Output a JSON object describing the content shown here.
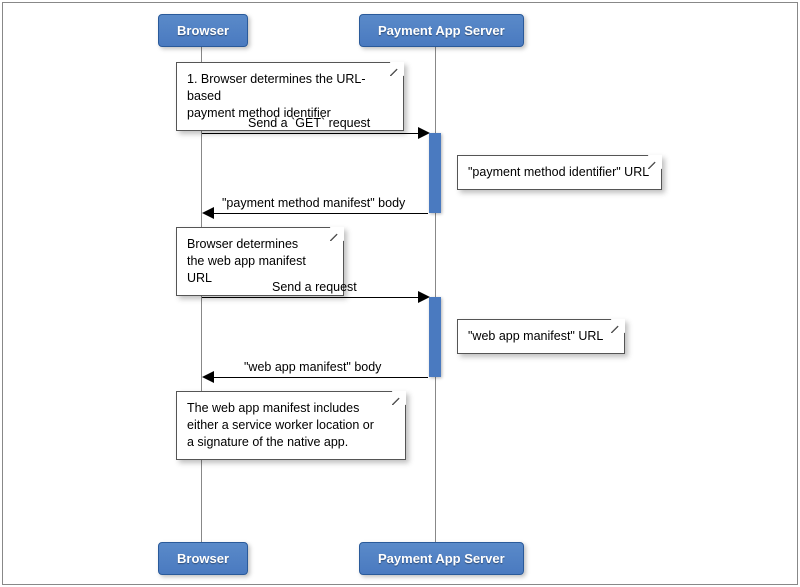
{
  "participants": {
    "browser": "Browser",
    "server": "Payment App Server"
  },
  "notes": {
    "n1": "1. Browser determines the URL-based\npayment method identifier",
    "n2": "\"payment method identifier\" URL",
    "n3": "Browser determines\nthe web app manifest URL",
    "n4": "\"web app manifest\" URL",
    "n5": "The web app manifest includes\neither a service worker location or\na signature of the native app."
  },
  "messages": {
    "m1": "Send a `GET` request",
    "m2": "\"payment method manifest\" body",
    "m3": "Send a request",
    "m4": "\"web app manifest\" body"
  },
  "chart_data": {
    "type": "table",
    "diagram_type": "uml-sequence",
    "participants": [
      "Browser",
      "Payment App Server"
    ],
    "sequence": [
      {
        "type": "note",
        "over": "Browser",
        "text": "1. Browser determines the URL-based payment method identifier"
      },
      {
        "type": "message",
        "from": "Browser",
        "to": "Payment App Server",
        "label": "Send a `GET` request"
      },
      {
        "type": "note",
        "over": "Payment App Server",
        "text": "\"payment method identifier\" URL"
      },
      {
        "type": "message",
        "from": "Payment App Server",
        "to": "Browser",
        "label": "\"payment method manifest\" body"
      },
      {
        "type": "note",
        "over": "Browser",
        "text": "Browser determines the web app manifest URL"
      },
      {
        "type": "message",
        "from": "Browser",
        "to": "Payment App Server",
        "label": "Send a request"
      },
      {
        "type": "note",
        "over": "Payment App Server",
        "text": "\"web app manifest\" URL"
      },
      {
        "type": "message",
        "from": "Payment App Server",
        "to": "Browser",
        "label": "\"web app manifest\" body"
      },
      {
        "type": "note",
        "over": "Browser",
        "text": "The web app manifest includes either a service worker location or a signature of the native app."
      }
    ]
  }
}
